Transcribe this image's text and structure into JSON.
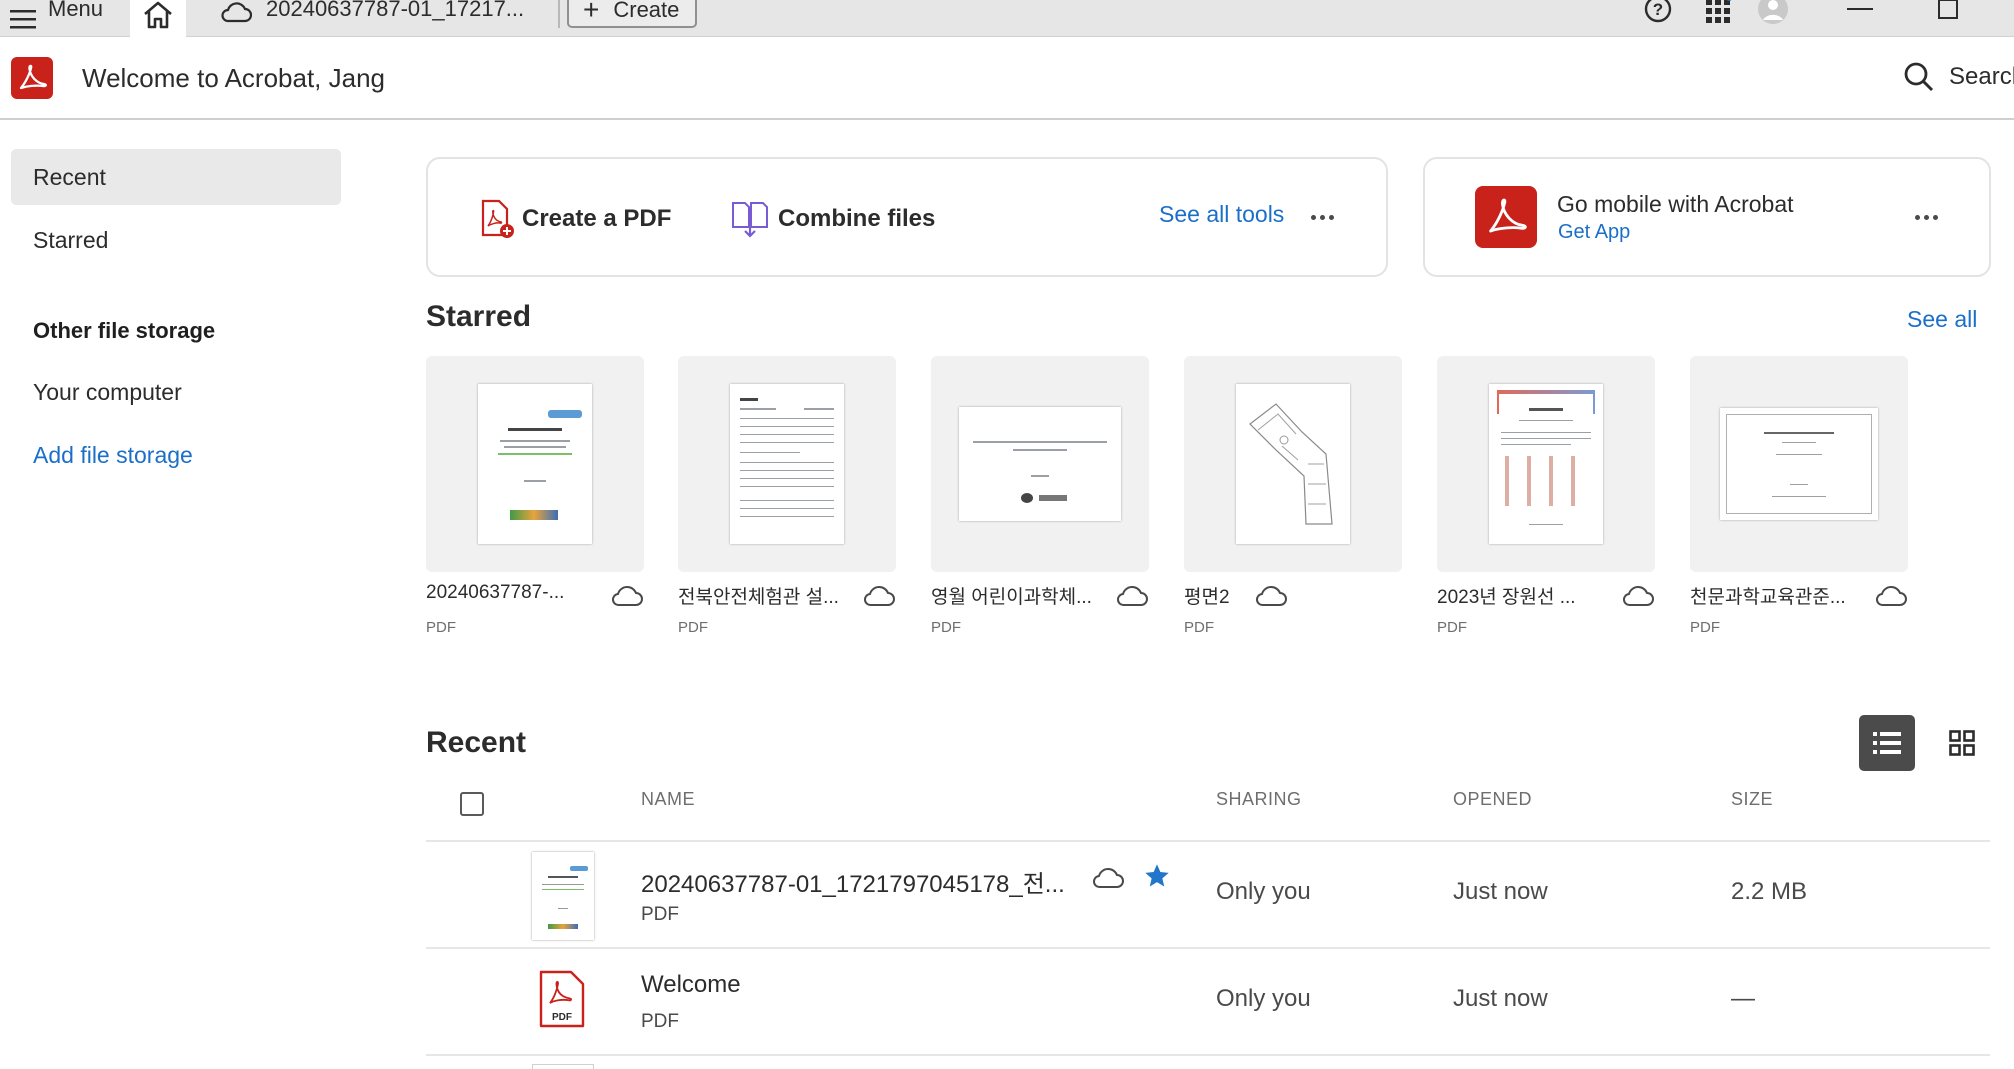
{
  "tabbar": {
    "menu_label": "Menu",
    "doc_tab_label": "20240637787-01_17217...",
    "create_label": "Create"
  },
  "header": {
    "welcome": "Welcome to Acrobat, Jang",
    "search_label": "Search"
  },
  "sidebar": {
    "recent": "Recent",
    "starred": "Starred",
    "other_heading": "Other file storage",
    "your_computer": "Your computer",
    "add_storage": "Add file storage"
  },
  "tools": {
    "create_pdf": "Create a PDF",
    "combine": "Combine files",
    "see_all_tools": "See all tools"
  },
  "mobile": {
    "title": "Go mobile with Acrobat",
    "link": "Get App"
  },
  "starred": {
    "title": "Starred",
    "see_all": "See all",
    "items": [
      {
        "name": "20240637787-...",
        "type": "PDF"
      },
      {
        "name": "전북안전체험관 설...",
        "type": "PDF"
      },
      {
        "name": "영월 어린이과학체...",
        "type": "PDF"
      },
      {
        "name": "평면2",
        "type": "PDF"
      },
      {
        "name": "2023년 장원선 ...",
        "type": "PDF"
      },
      {
        "name": "천문과학교육관준...",
        "type": "PDF"
      }
    ]
  },
  "recent": {
    "title": "Recent",
    "columns": {
      "name": "NAME",
      "sharing": "SHARING",
      "opened": "OPENED",
      "size": "SIZE"
    },
    "rows": [
      {
        "name": "20240637787-01_1721797045178_전...",
        "type": "PDF",
        "sharing": "Only you",
        "opened": "Just now",
        "size": "2.2 MB",
        "starred": true
      },
      {
        "name": "Welcome",
        "type": "PDF",
        "sharing": "Only you",
        "opened": "Just now",
        "size": "—",
        "starred": false
      }
    ]
  },
  "icons": {
    "pdf_badge": "PDF"
  },
  "colors": {
    "brand_red": "#c8221b",
    "link_blue": "#1b6fc9",
    "star_blue": "#2276c9"
  }
}
